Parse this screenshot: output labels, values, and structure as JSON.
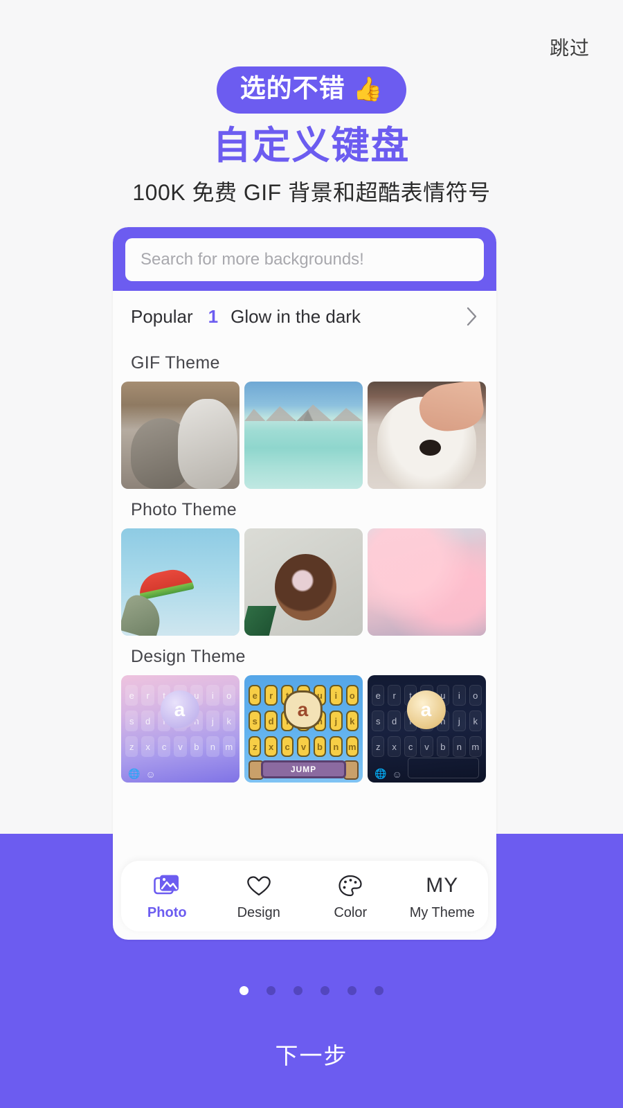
{
  "colors": {
    "accent": "#6C5CF0",
    "page_background": "#F7F7F8",
    "card_background": "#FCFCFC",
    "dot_inactive": "#5346BE",
    "dot_active": "#FFFFFF"
  },
  "header": {
    "skip_label": "跳过",
    "badge_text": "选的不错",
    "badge_emoji": "👍",
    "title": "自定义键盘",
    "subtitle": "100K 免费 GIF 背景和超酷表情符号"
  },
  "phone": {
    "search": {
      "placeholder": "Search for more backgrounds!",
      "value": ""
    },
    "popular": {
      "label": "Popular",
      "number": "1",
      "text": "Glow in the dark",
      "chevron": "chevron-right-icon"
    },
    "sections": [
      {
        "title": "GIF Theme",
        "items": [
          {
            "name": "two-kittens-gif",
            "style": "cats"
          },
          {
            "name": "overwater-bungalow-gif",
            "style": "beach"
          },
          {
            "name": "petted-samoyed-gif",
            "style": "dog"
          }
        ]
      },
      {
        "title": "Photo Theme",
        "items": [
          {
            "name": "watermelon-sky-photo",
            "style": "melon"
          },
          {
            "name": "ice-cream-sundae-photo",
            "style": "icecream"
          },
          {
            "name": "pink-clouds-photo",
            "style": "pinksky"
          }
        ]
      },
      {
        "title": "Design Theme",
        "items": [
          {
            "name": "purple-gradient-keyboard",
            "style": "kb-purple"
          },
          {
            "name": "pixel-game-keyboard",
            "style": "kb-yellow"
          },
          {
            "name": "dark-night-keyboard",
            "style": "kb-dark"
          }
        ]
      }
    ],
    "keyboard_rows": {
      "row1": [
        "e",
        "r",
        "t",
        "y",
        "u",
        "i",
        "o"
      ],
      "row2": [
        "s",
        "d",
        "f",
        "g",
        "h",
        "j",
        "k"
      ],
      "row3": [
        "z",
        "x",
        "c",
        "v",
        "b",
        "n",
        "m"
      ],
      "bubble_letter": "a",
      "jump_label": "JUMP"
    },
    "nav": [
      {
        "label": "Photo",
        "icon": "photo-stack-icon",
        "active": true
      },
      {
        "label": "Design",
        "icon": "heart-icon",
        "active": false
      },
      {
        "label": "Color",
        "icon": "palette-icon",
        "active": false
      },
      {
        "label": "My Theme",
        "icon": "my-text-icon",
        "active": false,
        "glyph": "MY"
      }
    ]
  },
  "footer": {
    "dots_total": 6,
    "dots_active_index": 0,
    "next_label": "下一步"
  }
}
